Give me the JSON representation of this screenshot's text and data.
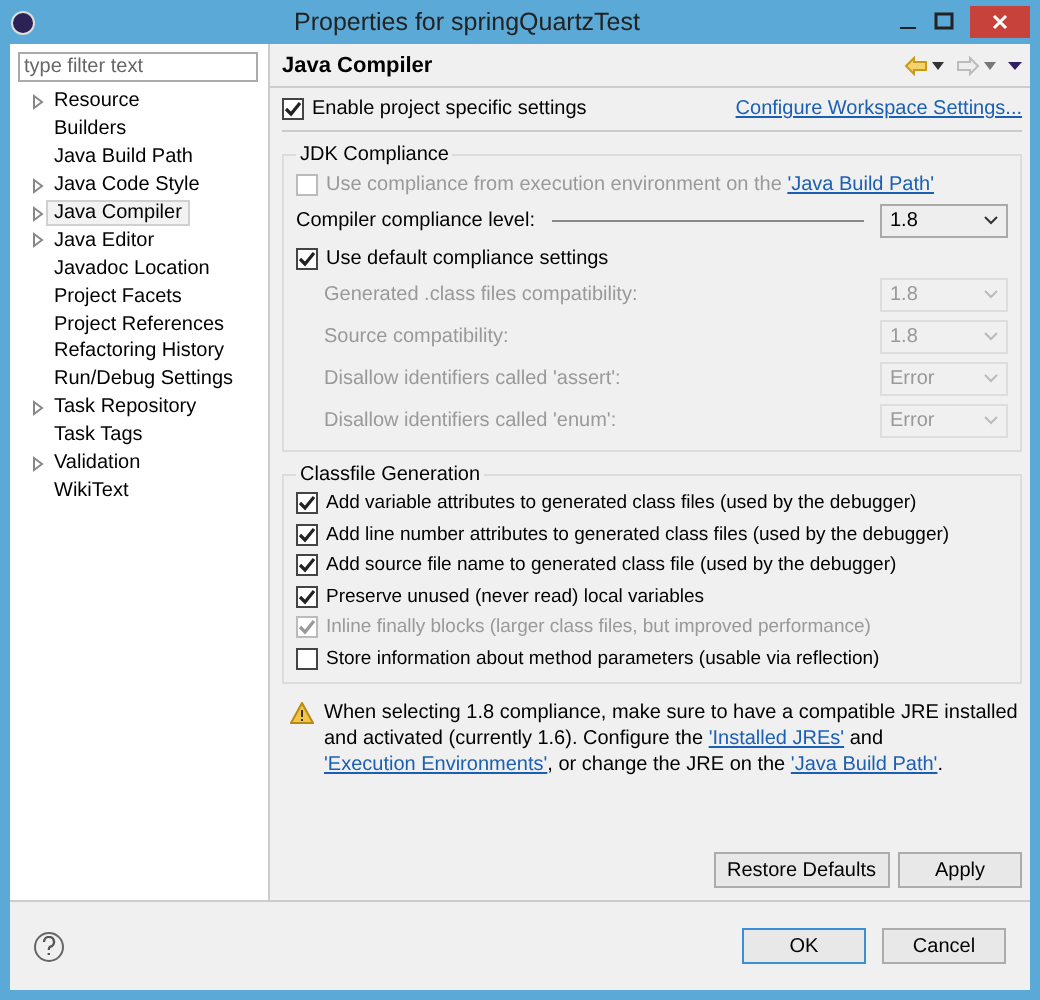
{
  "window": {
    "title": "Properties for springQuartzTest"
  },
  "sidebar": {
    "filter": {
      "placeholder": "type filter text"
    },
    "items": [
      {
        "label": "Resource",
        "expandable": true,
        "selected": false
      },
      {
        "label": "Builders",
        "expandable": false,
        "selected": false
      },
      {
        "label": "Java Build Path",
        "expandable": false,
        "selected": false
      },
      {
        "label": "Java Code Style",
        "expandable": true,
        "selected": false
      },
      {
        "label": "Java Compiler",
        "expandable": true,
        "selected": true
      },
      {
        "label": "Java Editor",
        "expandable": true,
        "selected": false
      },
      {
        "label": "Javadoc Location",
        "expandable": false,
        "selected": false
      },
      {
        "label": "Project Facets",
        "expandable": false,
        "selected": false
      },
      {
        "label": "Project References",
        "expandable": false,
        "selected": false
      },
      {
        "label": "Refactoring History",
        "expandable": false,
        "selected": false
      },
      {
        "label": "Run/Debug Settings",
        "expandable": false,
        "selected": false
      },
      {
        "label": "Task Repository",
        "expandable": true,
        "selected": false
      },
      {
        "label": "Task Tags",
        "expandable": false,
        "selected": false
      },
      {
        "label": "Validation",
        "expandable": true,
        "selected": false
      },
      {
        "label": "WikiText",
        "expandable": false,
        "selected": false
      }
    ]
  },
  "page": {
    "title": "Java Compiler",
    "back_enabled": true,
    "forward_enabled": false
  },
  "enable": {
    "label": "Enable project specific settings",
    "checked": true
  },
  "configure_link": "Configure Workspace Settings...",
  "jdk": {
    "title": "JDK Compliance",
    "use_ee": {
      "checked": false,
      "disabled": true,
      "segments": [
        {
          "text": "Use compliance from execution environment on the ",
          "link": false
        },
        {
          "text": "'Java Build Path'",
          "link": true
        }
      ]
    },
    "compliance": {
      "label": "Compiler compliance level:",
      "value": "1.8"
    },
    "use_default": {
      "label": "Use default compliance settings",
      "checked": true
    },
    "settings": [
      {
        "label": "Generated .class files compatibility:",
        "value": "1.8",
        "disabled": true
      },
      {
        "label": "Source compatibility:",
        "value": "1.8",
        "disabled": true
      },
      {
        "label": "Disallow identifiers called 'assert':",
        "value": "Error",
        "disabled": true
      },
      {
        "label": "Disallow identifiers called 'enum':",
        "value": "Error",
        "disabled": true
      }
    ]
  },
  "classfile": {
    "title": "Classfile Generation",
    "options": [
      {
        "label": "Add variable attributes to generated class files (used by the debugger)",
        "checked": true,
        "disabled": false
      },
      {
        "label": "Add line number attributes to generated class files (used by the debugger)",
        "checked": true,
        "disabled": false
      },
      {
        "label": "Add source file name to generated class file (used by the debugger)",
        "checked": true,
        "disabled": false
      },
      {
        "label": "Preserve unused (never read) local variables",
        "checked": true,
        "disabled": false
      },
      {
        "label": "Inline finally blocks (larger class files, but improved performance)",
        "checked": true,
        "disabled": true
      },
      {
        "label": "Store information about method parameters (usable via reflection)",
        "checked": false,
        "disabled": false
      }
    ]
  },
  "warning": {
    "segments": [
      {
        "text": "When selecting 1.8 compliance, make sure to have a compatible JRE installed and activated (currently 1.6). Configure the ",
        "link": false
      },
      {
        "text": "'Installed JREs'",
        "link": true
      },
      {
        "text": " and ",
        "link": false
      },
      {
        "text": "'Execution Environments'",
        "link": true
      },
      {
        "text": ", or change the JRE on the ",
        "link": false
      },
      {
        "text": "'Java Build Path'",
        "link": true
      },
      {
        "text": ".",
        "link": false
      }
    ]
  },
  "page_buttons": [
    "Restore Defaults",
    "Apply"
  ],
  "dialog_buttons": [
    {
      "label": "OK",
      "default": true
    },
    {
      "label": "Cancel",
      "default": false
    }
  ]
}
